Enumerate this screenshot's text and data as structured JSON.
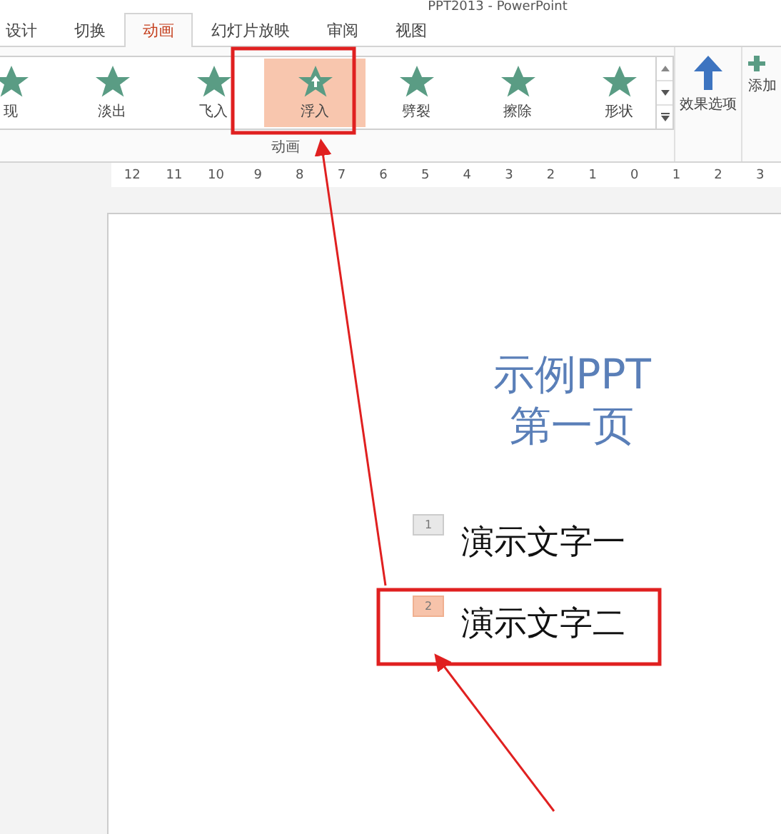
{
  "window": {
    "title": "PPT2013 - PowerPoint"
  },
  "tabs": [
    {
      "label": "设计",
      "selected": false
    },
    {
      "label": "切换",
      "selected": false
    },
    {
      "label": "动画",
      "selected": true
    },
    {
      "label": "幻灯片放映",
      "selected": false
    },
    {
      "label": "审阅",
      "selected": false
    },
    {
      "label": "视图",
      "selected": false
    }
  ],
  "gallery": {
    "group_label": "动画",
    "items": [
      {
        "label": "现",
        "selected": false
      },
      {
        "label": "淡出",
        "selected": false
      },
      {
        "label": "飞入",
        "selected": false
      },
      {
        "label": "浮入",
        "selected": true
      },
      {
        "label": "劈裂",
        "selected": false
      },
      {
        "label": "擦除",
        "selected": false
      },
      {
        "label": "形状",
        "selected": false
      }
    ]
  },
  "effect_options": {
    "label": "效果选项"
  },
  "add_animation": {
    "label": "添加"
  },
  "ruler": [
    "12",
    "11",
    "10",
    "9",
    "8",
    "7",
    "6",
    "5",
    "4",
    "3",
    "2",
    "1",
    "0",
    "1",
    "2",
    "3"
  ],
  "slide": {
    "title_lines": [
      "示例PPT",
      "第一页"
    ],
    "items": [
      {
        "order": "1",
        "text": "演示文字一",
        "selected": false
      },
      {
        "order": "2",
        "text": "演示文字二",
        "selected": true
      }
    ]
  }
}
